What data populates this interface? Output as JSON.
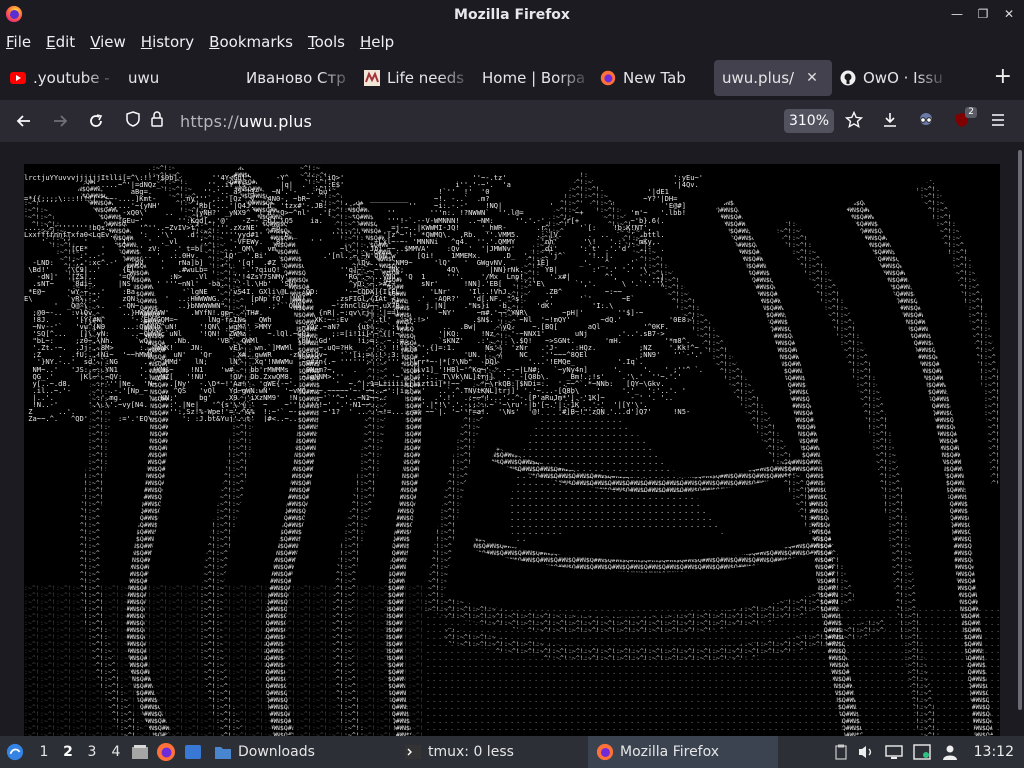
{
  "window": {
    "title": "Mozilla Firefox"
  },
  "menu": {
    "items": [
      {
        "label": "File",
        "u": "F",
        "rest": "ile"
      },
      {
        "label": "Edit",
        "u": "E",
        "rest": "dit"
      },
      {
        "label": "View",
        "u": "V",
        "rest": "iew"
      },
      {
        "label": "History",
        "u": "H",
        "rest": "istory"
      },
      {
        "label": "Bookmarks",
        "u": "B",
        "rest": "ookmarks"
      },
      {
        "label": "Tools",
        "u": "T",
        "rest": "ools"
      },
      {
        "label": "Help",
        "u": "H",
        "rest": "elp"
      }
    ]
  },
  "tabs": [
    {
      "label": ".youtube -",
      "icon": "youtube-icon"
    },
    {
      "label": "uwu",
      "icon": "none"
    },
    {
      "label": "Иваново Стр",
      "icon": "none"
    },
    {
      "label": "Life needs",
      "icon": "site-favicon"
    },
    {
      "label": "Home | Borpa",
      "icon": "none"
    },
    {
      "label": "New Tab",
      "icon": "firefox-icon"
    },
    {
      "label": "uwu.plus/",
      "icon": "none",
      "active": true,
      "close": "✕"
    },
    {
      "label": "OwO · Issu",
      "icon": "github-icon"
    }
  ],
  "navbar": {
    "url_scheme": "https://",
    "url_host": "uwu.plus",
    "zoom": "310%",
    "extension_badge": "2"
  },
  "page": {
    "ascii_lines": [
      "lrctjuYYuvvvjjjjjjItlli[=^\\:!!'!$0b]-       ''4Y<Gdl'      -Y^    ''::`iQ>'                              ''~-.tz'                                       ':yEu~'",
      "                 .....~^'|=dNQz_           ''..iY^ls~       |q|  .  ...:E$'                          i''.'-~'.  'a                                      '|4Qv.",
      "                         aBg=.            ''-'.._a>'!3~   ~N'.'-  ..'bu'                         !`''  !'  '0                                     '|dE1",
      "=*{{;;;;\\:::!!!!|'^~~-....]Kmt-      .ny'''`,:.'[Qz`_y' -4N0-, ~bR~              _________      ~!. -..`  .m?                                    ~Y?'|DH=",
      "                   ......'~{yNH'        'Rb[-...'|Q4J.  ^u' 'tzx#'-.JB:    '-_|           ''    ~i:.-.-'    !NQ|           '             '            'E@#]",
      "                       -xQ0\\'    ..    '|yNH?' _yNX9^ ^l_a!*Q>~^nl'  .'[             ''        '''n:. !?NWWN`  ''.l@=            ~+           'm'~   '.lbb!",
      "                      :GEu~'        '':Kqd[..'@'   -Z~- ~bJ.\\Q5    ia.               '''!-`.--V-WMNNN!  ..~NM:     ''.'.-'   .'r[+            ~'b}.6(.",
      ".....'~''''''''!bQs.'      '^''..~ZvIV>t^    '''.zXzNE'   =b_                        _=j-~..|KWWMI-JQ!     '_hWR-       .r^       '`[:    !b:K!NT',",
      "LxxffffnnfTxfa0<LqEv.-     ':  .'\\'   .d'`^^  ''''yyd#1'  _^'b'_        '''''''     '[z^~'!- *QWMQ\\.  ,Rb.  ''.VMM5.    .:`[V.      .  ..    `' .bttl.",
      "    '    ''   '      :`1'    '  ._vl     '.     '-VFEWy.   8l      ' '            ~Lxl~-~- 'MNNNi   ^q4.  ''.'.QMMY      'nh'      '\\!   '.:' .'mKy,.",
      "           |CE*   '    '...' zV:   .' t=b[  '   .'_QM\\   vm               ~l'  .'Jbi.~~..$MMVA'    :Qv  '  '|JMWNv'      .di'     ':`t' .'.'d'  .:-  .",
      "             :'..-'     `   .. '  .:.0Hv.      lQ'  '.Bi'             .'[nl..~ ~N'QNN^w`    [Qi!    1MMEMx.     .D_  '.  ..'j^`     '!..|.",
      "  -LND:    '..':xc^.-'   'pv    '   rNa]b]    ,'  '[q!  .#Z                  .lQv..^...NM9~     'lQ'   '  GWgvNV.       1E]       _'.  _^    .'`",
      " \\Bd!'    '\\C9|..'     {El      '   .#wuLb=     '  '.'?qiuQ!              ''q]~-..~-.JNK;          4Q\\       |NN}rNk.     YB|        :' '.' '.' '\\",
      "   -dN]'   |ZS!..     '=Qv        :N>   .Vl      ''!4ZsY7SNMy'             'RG^.~-..yNu. 'Q  1     '''.    '/Mx  Lnp!      '.x#|        ^',     '`'..|",
      "  .sNT~     8di~.     |NS      ' '''~nNl'  -ba.  ''-l.\\Hb'  'SNi            ^yQ:-~.>#Z~      sNr'      !NN].'EB[     '''E\\       `','.      \\ '.`'.''\\",
      " *E@~     'wY_~...'    :Ba           '`lgNE  '  'vS4I. GXli\\@L.' :QD:      '-~CQDX]{I[EL       'LNr'    'Il..!VhJ.        .ZB^          ~:~~",
      "E\\        `yR\\.-.'     zQN:      '  ..:HWWWWG.       [pNp`fQ' |NN|       .zsFIGl,(IAt_<;    .'  -AQR?'   'd[.NF. \"^s'     ,'      '`'       ~E`",
      "       '  _Q@^\\  ..   .-QN~         ..}bNWWWWN\"      '   .;'``QNN|      ~'zhnClGV~~,uX7R:`    j.|N]    .\"Ns}i  -b.      'dK'         'I:.\\",
      "  ;@0~-..  :vlQv       ..}HWWWWWW'     .WYfN!.gp~  'TH#.             {nR|.~:qv\\rj| '|==!.        ~NY'     ~m#.'~~^YNR\\        ~pH|'        ''$]-~",
      "  !8J.      '[Y{#N^      '-:EWWGQM=~       lNg-fsINs  _QWh          XK:~-:Ev     '.tl'  '>*:!>'          .$N$.      ~Nl  '~!mQY'       ~dQ.'           '0E8:'",
      "  ~Nv--'`   'vu^{N9    ...:QWMNh^uN!     '!QN\\ .wgM?' >MMY       ~YQz.~aN?    {ut!.  `:{,].       ..  .Bw|     'yQ.    ~.[BQ[       aQl          '^0KF.",
      "  'SQ[^...   []\\`yN:     ..~QWWNc`uNl    '!QN! `ZWMz     ~.lQl.~GQi     ;:=[i!1i[\"~^{[!~'        '|KQ:     !Nz    '-~NNX1'       uNj       .'..'.sB7->",
      "  \"bL~:     ;z0~.\\Nh.     `wQ|     .Nb.      'VB^ _QWMl         \\bN_'Gd'      !i:=:  ~.:=:.'     `sKNZ'   .:'.    \\.$Q!   ~>SGNt.       'mH.          '*m8^.",
      "  '.Zt.-~.  .Jj-..8M>      :..@WWK!    JN:      vEl   wn.`]MWMl      ~.uQ=?Hk_    ':' !!'[j>^'.{]=:1.       Ns'!  'zNr   .'J-   .:HQz.          ;NZ    '.Kk!^~",
      "  ;Z    .  .fU;..!Ni~  '~~hMWM`    uN'   'Qr      X#._gwWR    -zNCGlQv~   '`'[i;=!:!';3:'    .'        'UN.    /    NC   .''~~~^8QEl            ;NN9'   ''`-'.'",
      "   '}NY.-..'  sd'.`:NG      ..'~^MMd'   lN;     lN^   Xq'!NWWMu  ~q#zn{.~ '''''':'''.'''.^)lrr*~-|*[?\\Nb\"   DQl       '...'!EMQe_          '.Iq`.",
      "  NM~..'   'JS:.~..YN1     '..!KM$~    !N1    'w#    bb'rMWMMs   _0Nem?~,    .          '  [lv1]_'!HBl~'^Kq~' '..~.~|LN#;   `~yNy4n]      '.     '.   ' ;''^ `.",
      "  QG_.'      |Kl~`.~QV:    '.'.yMZ[   '!NU'     !QV  Db.ZxwQM8.  ~'gNNM>.''           '~'.'.'':.._T\\Vk\\NL]trj]  '.'_-[Q8b\\.    _Bm!.;!s'    .'\\.'  ''~.'.'",
      "  y[..~.d8.      .-'''|Ne.  'N~   .[Ny'  -.\\D*~!'Aa!'  'gWE{-~'.  .      '  ~.^|:1=Liiiiil[lizt1i]*!~~`    '~\\rkQB:|$NDi=:.  '.~~^`.*~NNb:   [QY~\\Gkv.",
      "  .il..~.'-         .-.'[Np_~      ^QS   'vQl   Yd~gWN:wN'   '~vMQ:~.~.~~~~~'~-'~~..~':|i:'..'   ..`.^.TNVtKNL]trj]' '.'~...-[Q8b\\    '     '.'_  ':'..'. ' ",
      "  |..'.        ``.'.mg.      '.:KN;'     bg'   .X9  'iXzNM9'  !N     ~'`'^~'..~N1~~..      -..  .'.!'  .:~~'!...'..^-.[P'aRuJm*'|.-'1K]~      - ' '. '..",
      "  !N..-'       '.\\.\\'.~vy[N4.    .:'.|Ne|   '^{s'\\'{`'  ~    ~'''''''!~' '.'-N1~~..          '.|\"!\\'.'.-.:'..~`'~\\ru'-|b'[~.'|:-1K   '-'  '|[Y'\\'.",
      " Z      ..'.                      '':,Sz!%-Wpe!'='.^&%  !:~'` ~-..    ~'1?  ' .. .'~!=....-=' ~~`|. '~''\"=a!.  '\\Ns'  '@!    '#]B~!\"'zQN '...d']Q7'     !N5-",
      " Za~~.^.   ^QD'       :='.'EQ\\-      ':_:J.bt&Yuj'..t'  |#<..~..     "
    ],
    "ascii_credit": ""
  },
  "taskbar": {
    "workspaces": [
      "1",
      "2",
      "3",
      "4"
    ],
    "active_workspace": "2",
    "tasks": [
      {
        "label": "Downloads",
        "icon": "folder-icon"
      },
      {
        "label": "tmux: 0 less",
        "icon": "terminal-icon"
      },
      {
        "label": "Mozilla Firefox",
        "icon": "firefox-icon",
        "active": true
      }
    ],
    "clock": "13:12"
  }
}
